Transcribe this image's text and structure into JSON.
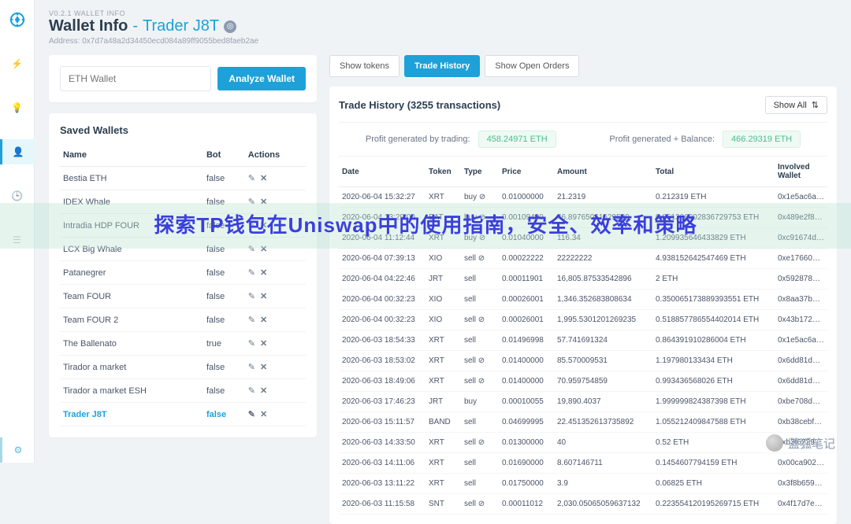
{
  "version": "V0.2.1 WALLET INFO",
  "title_main": "Wallet Info",
  "title_sep": "-",
  "trader": "Trader J8T",
  "address_label": "Address:",
  "address": "0x7d7a48a2d34450ecd084a89ff9055bed8faeb2ae",
  "search_placeholder": "ETH Wallet",
  "analyze_btn": "Analyze Wallet",
  "saved_title": "Saved Wallets",
  "saved_cols": {
    "name": "Name",
    "bot": "Bot",
    "actions": "Actions"
  },
  "saved": [
    {
      "name": "Bestia ETH",
      "bot": "false",
      "active": false
    },
    {
      "name": "IDEX Whale",
      "bot": "false",
      "active": false
    },
    {
      "name": "Intradia HDP FOUR",
      "bot": "false",
      "active": false
    },
    {
      "name": "LCX Big Whale",
      "bot": "false",
      "active": false
    },
    {
      "name": "Patanegrer",
      "bot": "false",
      "active": false
    },
    {
      "name": "Team FOUR",
      "bot": "false",
      "active": false
    },
    {
      "name": "Team FOUR 2",
      "bot": "false",
      "active": false
    },
    {
      "name": "The Ballenato",
      "bot": "true",
      "active": false
    },
    {
      "name": "Tirador a market",
      "bot": "false",
      "active": false
    },
    {
      "name": "Tirador a market ESH",
      "bot": "false",
      "active": false
    },
    {
      "name": "Trader J8T",
      "bot": "false",
      "active": true
    }
  ],
  "tabs": {
    "tokens": "Show tokens",
    "history": "Trade History",
    "orders": "Show Open Orders"
  },
  "history_title_prefix": "Trade History",
  "history_count": "(3255 transactions)",
  "show_all": "Show All",
  "profit_trading_label": "Profit generated by trading:",
  "profit_trading_val": "458.24971 ETH",
  "profit_balance_label": "Profit generated + Balance:",
  "profit_balance_val": "466.29319 ETH",
  "hist_cols": {
    "date": "Date",
    "token": "Token",
    "type": "Type",
    "price": "Price",
    "amount": "Amount",
    "total": "Total",
    "wallet": "Involved Wallet"
  },
  "trades": [
    {
      "date": "2020-06-04 15:32:27",
      "token": "XRT",
      "type": "buy",
      "icon": "⊘",
      "price": "0.01000000",
      "amount": "21.2319",
      "total": "0.212319 ETH",
      "wallet": "0x1e5ac6a2663f..."
    },
    {
      "date": "2020-06-04 13:29:00",
      "token": "BAT",
      "type": "buy",
      "icon": "⊘",
      "price": "0.00109400",
      "amount": "46.89765061629529",
      "total": "0.051306002836729753 ETH",
      "wallet": "0x489e2f84d9a1..."
    },
    {
      "date": "2020-06-04 11:12:44",
      "token": "XRT",
      "type": "buy",
      "icon": "⊘",
      "price": "0.01040000",
      "amount": "116.34",
      "total": "1.209935646433829 ETH",
      "wallet": "0xc91674d315cc..."
    },
    {
      "date": "2020-06-04 07:39:13",
      "token": "XIO",
      "type": "sell",
      "icon": "⊘",
      "price": "0.00022222",
      "amount": "22222222",
      "total": "4.938152642547469 ETH",
      "wallet": "0xe176603a291f..."
    },
    {
      "date": "2020-06-04 04:22:46",
      "token": "JRT",
      "type": "sell",
      "icon": "",
      "price": "0.00011901",
      "amount": "16,805.87533542896",
      "total": "2 ETH",
      "wallet": "0x592878b0483..."
    },
    {
      "date": "2020-06-04 00:32:23",
      "token": "XIO",
      "type": "sell",
      "icon": "",
      "price": "0.00026001",
      "amount": "1,346.352683808634",
      "total": "0.350065173889393551 ETH",
      "wallet": "0x8aa37b0631a..."
    },
    {
      "date": "2020-06-04 00:32:23",
      "token": "XIO",
      "type": "sell",
      "icon": "⊘",
      "price": "0.00026001",
      "amount": "1,995.5301201269235",
      "total": "0.518857786554402014 ETH",
      "wallet": "0x43b17219ecd9..."
    },
    {
      "date": "2020-06-03 18:54:33",
      "token": "XRT",
      "type": "sell",
      "icon": "",
      "price": "0.01496998",
      "amount": "57.741691324",
      "total": "0.864391910286004 ETH",
      "wallet": "0x1e5ac6a2663f..."
    },
    {
      "date": "2020-06-03 18:53:02",
      "token": "XRT",
      "type": "sell",
      "icon": "⊘",
      "price": "0.01400000",
      "amount": "85.570009531",
      "total": "1.197980133434 ETH",
      "wallet": "0x6dd81d5d90a..."
    },
    {
      "date": "2020-06-03 18:49:06",
      "token": "XRT",
      "type": "sell",
      "icon": "⊘",
      "price": "0.01400000",
      "amount": "70.959754859",
      "total": "0.993436568026 ETH",
      "wallet": "0x6dd81d5d90a..."
    },
    {
      "date": "2020-06-03 17:46:23",
      "token": "JRT",
      "type": "buy",
      "icon": "",
      "price": "0.00010055",
      "amount": "19,890.4037",
      "total": "1.999999824387398 ETH",
      "wallet": "0xbe708d227f6d..."
    },
    {
      "date": "2020-06-03 15:11:57",
      "token": "BAND",
      "type": "sell",
      "icon": "",
      "price": "0.04699995",
      "amount": "22.451352613735892",
      "total": "1.055212409847588 ETH",
      "wallet": "0xb38cebfbf22a..."
    },
    {
      "date": "2020-06-03 14:33:50",
      "token": "XRT",
      "type": "sell",
      "icon": "⊘",
      "price": "0.01300000",
      "amount": "40",
      "total": "0.52 ETH",
      "wallet": "0xb3f672982f31..."
    },
    {
      "date": "2020-06-03 14:11:06",
      "token": "XRT",
      "type": "sell",
      "icon": "",
      "price": "0.01690000",
      "amount": "8.607146711",
      "total": "0.1454607794159 ETH",
      "wallet": "0x00ca9022e61..."
    },
    {
      "date": "2020-06-03 13:11:22",
      "token": "XRT",
      "type": "sell",
      "icon": "",
      "price": "0.01750000",
      "amount": "3.9",
      "total": "0.06825 ETH",
      "wallet": "0x3f8b6592d24e..."
    },
    {
      "date": "2020-06-03 11:15:58",
      "token": "SNT",
      "type": "sell",
      "icon": "⊘",
      "price": "0.00011012",
      "amount": "2,030.05065059637132",
      "total": "0.223554120195269715 ETH",
      "wallet": "0x4f17d7e29b6f..."
    }
  ],
  "overlay_text": "探索TP钱包在Uniswap中的使用指南，安全、效率和策略",
  "watermark": "蓝狐笔记"
}
